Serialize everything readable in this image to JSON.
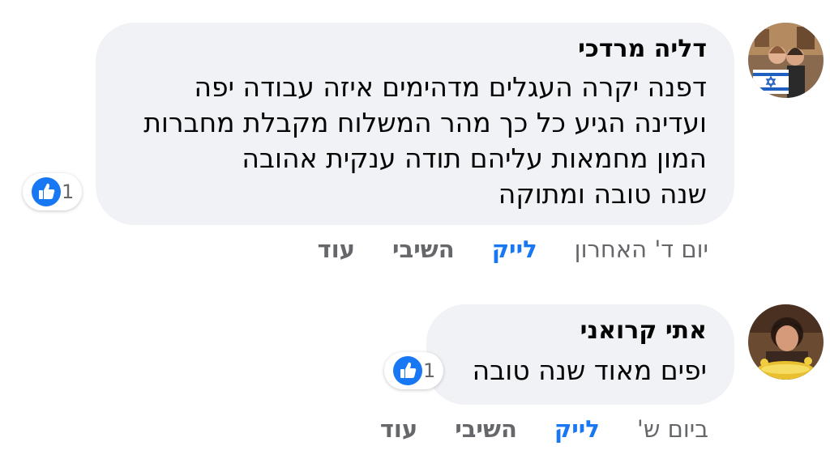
{
  "comments": [
    {
      "author": "דליה מרדכי",
      "lines": [
        "דפנה יקרה העגלים מדהימים איזה עבודה יפה",
        "ועדינה הגיע כל כך מהר המשלוח מקבלת מחברות",
        "המון מחמאות עליהם תודה ענקית אהובה",
        "שנה טובה ומתוקה"
      ],
      "reaction_count": "1",
      "time": "יום ד' האחרון",
      "like_label": "לייק",
      "reply_label": "השיבי",
      "more_label": "עוד"
    },
    {
      "author": "אתי קרואני",
      "lines": [
        "יפים מאוד שנה טובה"
      ],
      "reaction_count": "1",
      "time": "ביום ש'",
      "like_label": "לייק",
      "reply_label": "השיבי",
      "more_label": "עוד"
    }
  ],
  "colors": {
    "bubble": "#f0f2f5",
    "like_blue": "#1877f2",
    "meta_gray": "#65676b",
    "text": "#050505"
  },
  "icons": [
    "thumbs-up-icon"
  ]
}
